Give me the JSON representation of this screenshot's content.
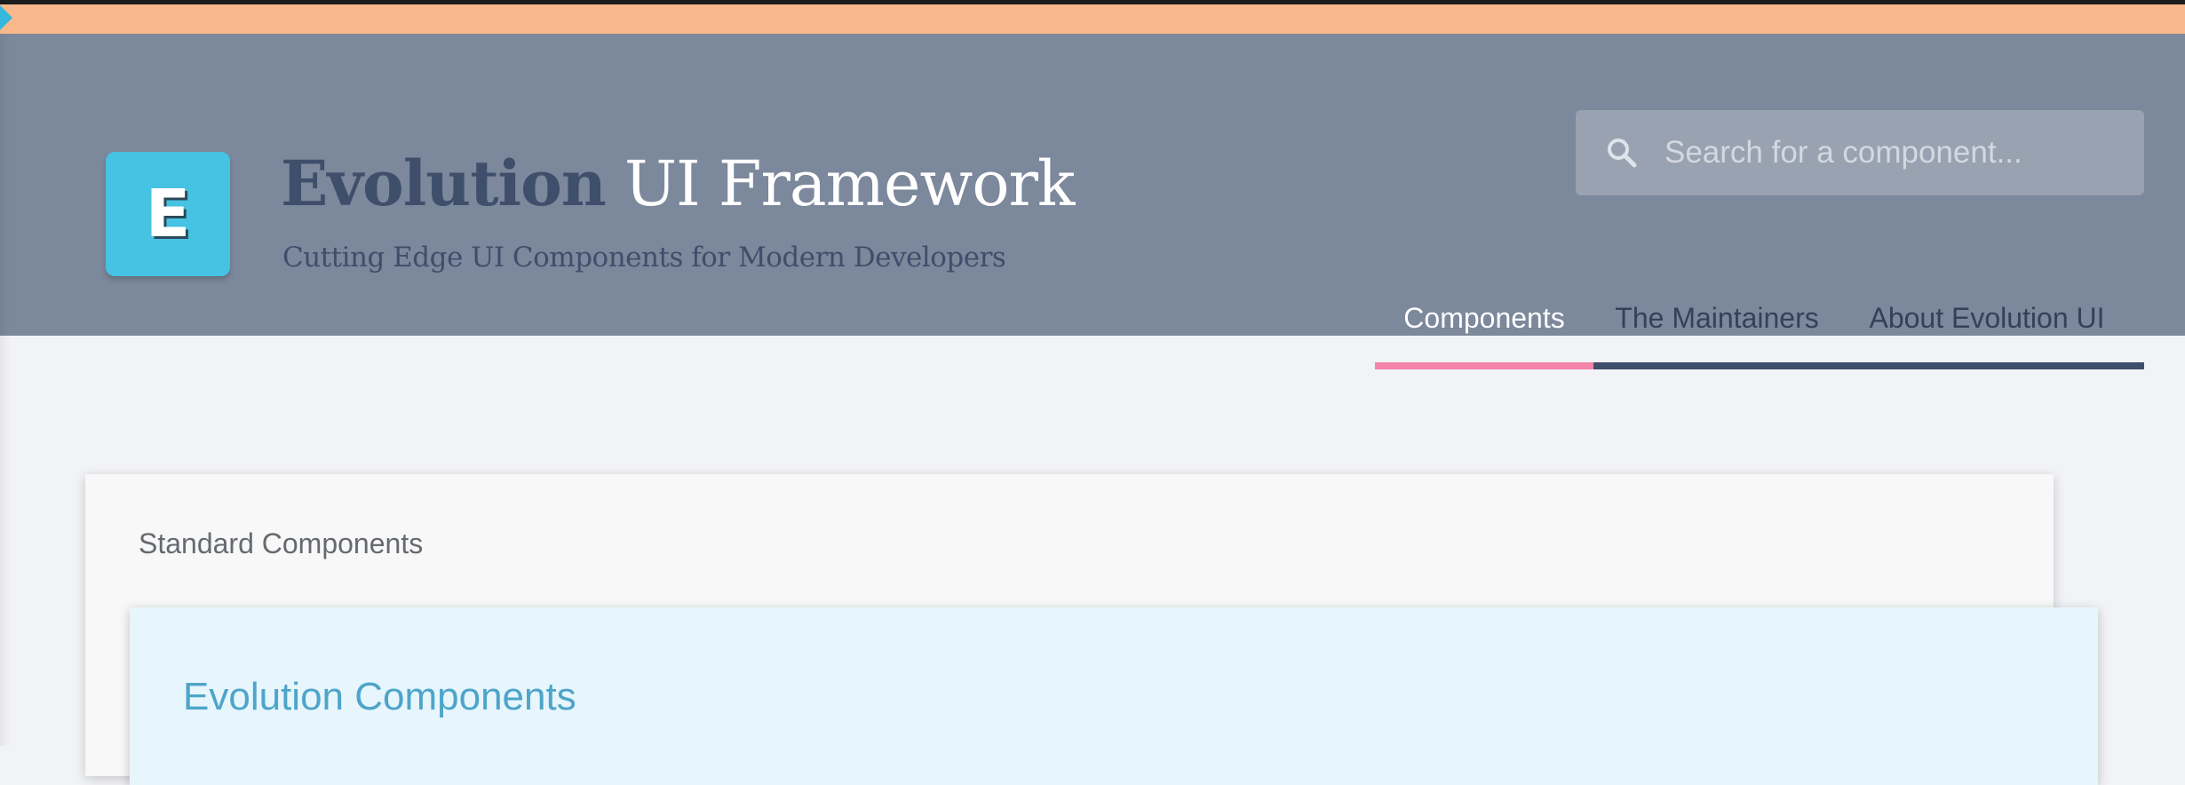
{
  "brand": {
    "logo_letter": "E",
    "title_strong": "Evolution",
    "title_light": "UI Framework",
    "tagline": "Cutting Edge UI Components for Modern Developers"
  },
  "search": {
    "placeholder": "Search for a component...",
    "value": "",
    "icon": "search-icon"
  },
  "nav": {
    "items": [
      {
        "label": "Components",
        "active": true
      },
      {
        "label": "The Maintainers",
        "active": false
      },
      {
        "label": "About Evolution UI",
        "active": false
      }
    ]
  },
  "main": {
    "section_title": "Standard Components",
    "subsection_title": "Evolution Components"
  },
  "colors": {
    "top_strip": "#f9b88b",
    "header_bg": "#7c889b",
    "logo": "#46c2e3",
    "brand_dark": "#3f4e6b",
    "nav_active_underline": "#f384a9",
    "inner_title": "#4da5c9",
    "inner_card_bg": "#e7f5fd"
  }
}
